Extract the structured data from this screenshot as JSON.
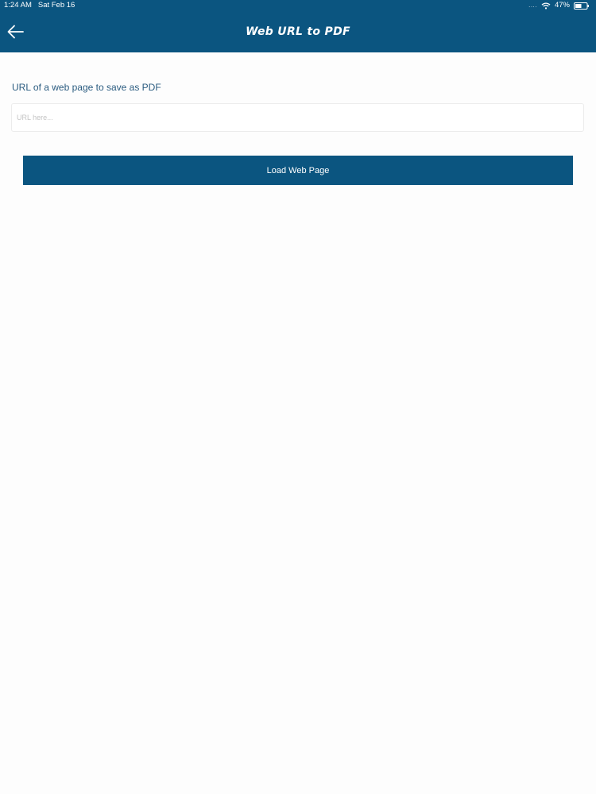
{
  "status_bar": {
    "time": "1:24 AM",
    "date": "Sat Feb 16",
    "signal": "....",
    "battery_percent": "47%",
    "icons": [
      "wifi-icon",
      "battery-icon"
    ]
  },
  "nav": {
    "title": "Web URL to PDF",
    "back_icon": "back-arrow-icon"
  },
  "form": {
    "label": "URL of a web page to save as PDF",
    "url_placeholder": "URL here...",
    "url_value": "",
    "load_button_label": "Load Web Page"
  },
  "colors": {
    "primary": "#0b5580",
    "label_text": "#2b5c80",
    "background": "#fdfdfd"
  }
}
